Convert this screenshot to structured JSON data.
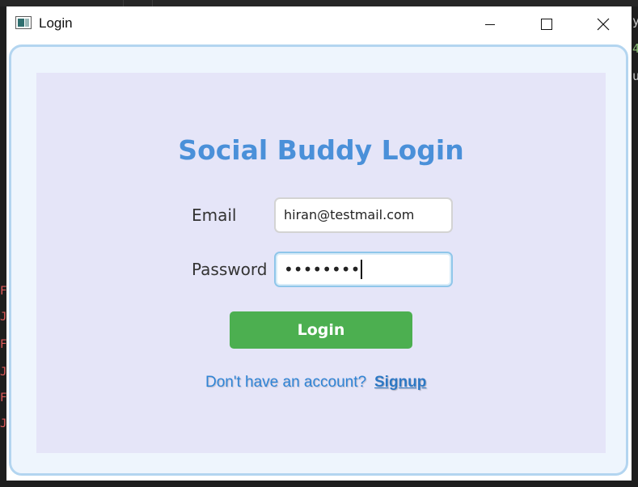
{
  "window": {
    "title": "Login",
    "minimize_icon": "minimize-icon",
    "maximize_icon": "maximize-icon",
    "close_icon": "close-icon"
  },
  "form": {
    "heading": "Social Buddy Login",
    "email_label": "Email",
    "email_value": "hiran@testmail.com",
    "password_label": "Password",
    "password_value": "••••••••",
    "login_label": "Login",
    "signup_prompt": "Don't have an account?",
    "signup_link": "Signup"
  },
  "colors": {
    "heading": "#4a90d9",
    "login_button": "#4caf50",
    "panel": "#e5e5f8",
    "link": "#2d78c4"
  }
}
